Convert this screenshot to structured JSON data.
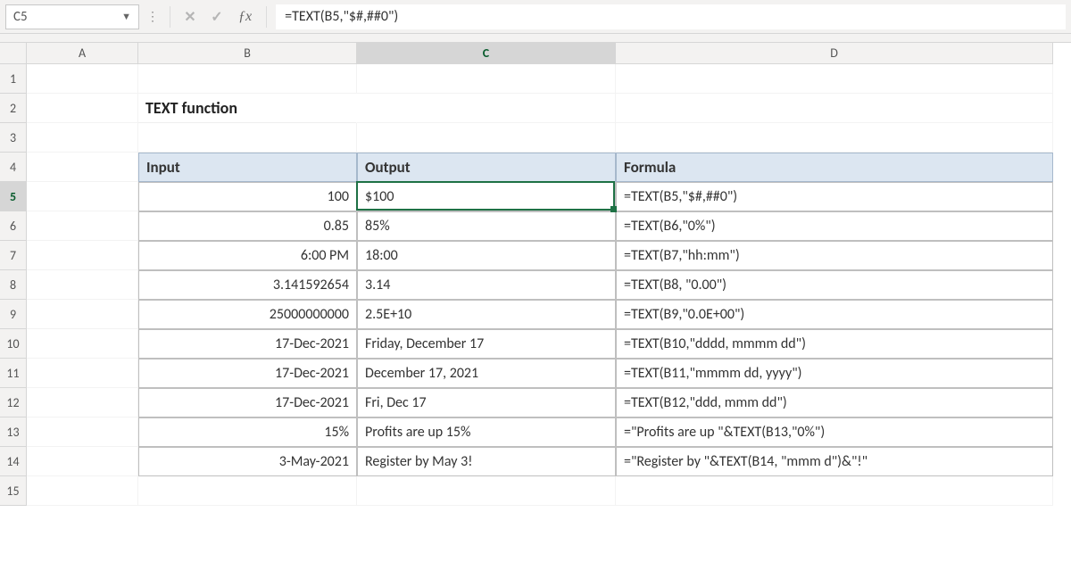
{
  "nameBox": "C5",
  "formulaBar": "=TEXT(B5,\"$#,##0\")",
  "columns": [
    "A",
    "B",
    "C",
    "D"
  ],
  "rowCount": 15,
  "selected": {
    "col": "C",
    "row": 5
  },
  "title": "TEXT function",
  "headers": {
    "input": "Input",
    "output": "Output",
    "formula": "Formula"
  },
  "rows": [
    {
      "input": "100",
      "output": "$100",
      "formula": "=TEXT(B5,\"$#,##0\")"
    },
    {
      "input": "0.85",
      "output": "85%",
      "formula": "=TEXT(B6,\"0%\")"
    },
    {
      "input": "6:00 PM",
      "output": "18:00",
      "formula": "=TEXT(B7,\"hh:mm\")"
    },
    {
      "input": "3.141592654",
      "output": "3.14",
      "formula": "=TEXT(B8, \"0.00\")"
    },
    {
      "input": "25000000000",
      "output": "2.5E+10",
      "formula": "=TEXT(B9,\"0.0E+00\")"
    },
    {
      "input": "17-Dec-2021",
      "output": "Friday, December 17",
      "formula": "=TEXT(B10,\"dddd, mmmm dd\")"
    },
    {
      "input": "17-Dec-2021",
      "output": "December 17, 2021",
      "formula": "=TEXT(B11,\"mmmm dd, yyyy\")"
    },
    {
      "input": "17-Dec-2021",
      "output": "Fri, Dec 17",
      "formula": "=TEXT(B12,\"ddd, mmm dd\")"
    },
    {
      "input": "15%",
      "output": "Profits are up 15%",
      "formula": "=\"Profits are up \"&TEXT(B13,\"0%\")"
    },
    {
      "input": "3-May-2021",
      "output": "Register by May 3!",
      "formula": "=\"Register by \"&TEXT(B14, \"mmm d\")&\"!\""
    }
  ]
}
